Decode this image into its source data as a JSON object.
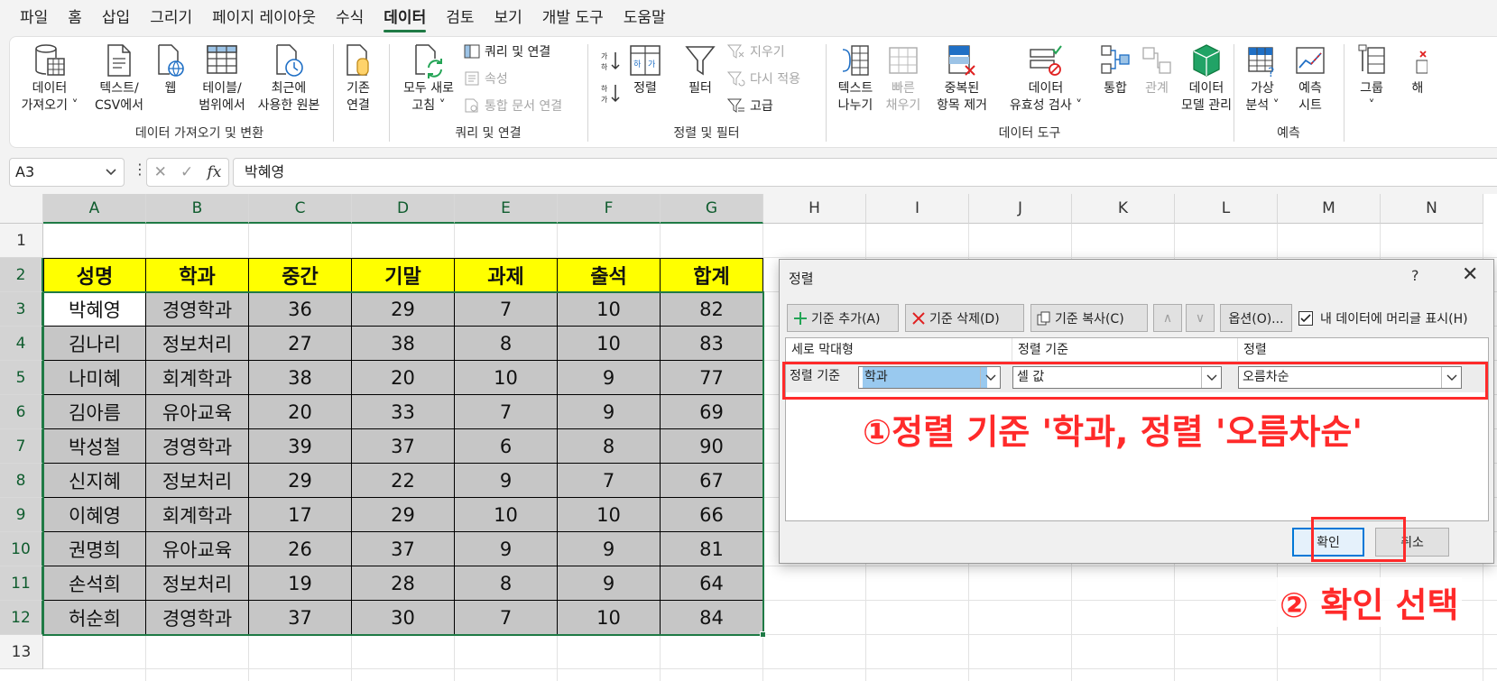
{
  "menu": {
    "tabs": [
      "파일",
      "홈",
      "삽입",
      "그리기",
      "페이지 레이아웃",
      "수식",
      "데이터",
      "검토",
      "보기",
      "개발 도구",
      "도움말"
    ],
    "active": "데이터"
  },
  "ribbon": {
    "get_data": {
      "title": "데이터 가져오기 및 변환",
      "get_data": [
        "데이터",
        "가져오기 ˅"
      ],
      "text_csv": [
        "텍스트/",
        "CSV에서"
      ],
      "web": "웹",
      "table_range": [
        "테이블/",
        "범위에서"
      ],
      "recent": [
        "최근에",
        "사용한 원본"
      ],
      "existing": [
        "기존",
        "연결"
      ]
    },
    "queries": {
      "title": "쿼리 및 연결",
      "refresh": [
        "모두 새로",
        "고침 ˅"
      ],
      "queries_conn": "쿼리 및 연결",
      "properties": "속성",
      "edit_links": "통합 문서 연결"
    },
    "sort_filter": {
      "title": "정렬 및 필터",
      "sort": "정렬",
      "filter": "필터",
      "clear": "지우기",
      "reapply": "다시 적용",
      "advanced": "고급"
    },
    "data_tools": {
      "title": "데이터 도구",
      "text_to_cols": [
        "텍스트",
        "나누기"
      ],
      "flash_fill": [
        "빠른",
        "채우기"
      ],
      "remove_dup": [
        "중복된",
        "항목 제거"
      ],
      "validation": [
        "데이터",
        "유효성 검사 ˅"
      ],
      "consolidate": "통합",
      "relations": "관계",
      "data_model": [
        "데이터",
        "모델 관리"
      ]
    },
    "forecast": {
      "title": "예측",
      "whatif": [
        "가상",
        "분석 ˅"
      ],
      "sheet": [
        "예측",
        "시트"
      ]
    },
    "outline": {
      "group": [
        "그룹",
        "˅"
      ],
      "ungroup_partial": "해"
    }
  },
  "formula_bar": {
    "name_box": "A3",
    "value": "박혜영",
    "fx": "fx"
  },
  "columns": [
    "A",
    "B",
    "C",
    "D",
    "E",
    "F",
    "G",
    "H",
    "I",
    "J",
    "K",
    "L",
    "M",
    "N"
  ],
  "rows": [
    "1",
    "2",
    "3",
    "4",
    "5",
    "6",
    "7",
    "8",
    "9",
    "10",
    "11",
    "12",
    "13"
  ],
  "table": {
    "headers": [
      "성명",
      "학과",
      "중간",
      "기말",
      "과제",
      "출석",
      "합계"
    ],
    "rows": [
      [
        "박혜영",
        "경영학과",
        "36",
        "29",
        "7",
        "10",
        "82"
      ],
      [
        "김나리",
        "정보처리",
        "27",
        "38",
        "8",
        "10",
        "83"
      ],
      [
        "나미혜",
        "회계학과",
        "38",
        "20",
        "10",
        "9",
        "77"
      ],
      [
        "김아름",
        "유아교육",
        "20",
        "33",
        "7",
        "9",
        "69"
      ],
      [
        "박성철",
        "경영학과",
        "39",
        "37",
        "6",
        "8",
        "90"
      ],
      [
        "신지혜",
        "정보처리",
        "29",
        "22",
        "9",
        "7",
        "67"
      ],
      [
        "이혜영",
        "회계학과",
        "17",
        "29",
        "10",
        "10",
        "66"
      ],
      [
        "권명희",
        "유아교육",
        "26",
        "37",
        "9",
        "9",
        "81"
      ],
      [
        "손석희",
        "정보처리",
        "19",
        "28",
        "8",
        "9",
        "64"
      ],
      [
        "허순희",
        "경영학과",
        "37",
        "30",
        "7",
        "10",
        "84"
      ]
    ]
  },
  "dialog": {
    "title": "정렬",
    "help": "?",
    "close": "✕",
    "add_level": "기준 추가(A)",
    "delete_level": "기준 삭제(D)",
    "copy_level": "기준 복사(C)",
    "up": "∧",
    "down": "∨",
    "options": "옵션(O)...",
    "has_headers": "내 데이터에 머리글 표시(H)",
    "col_headers": {
      "column": "세로 막대형",
      "sort_on": "정렬 기준",
      "order": "정렬"
    },
    "row": {
      "label": "정렬 기준",
      "column": "학과",
      "sort_on": "셀 값",
      "order": "오름차순"
    },
    "ok": "확인",
    "cancel": "취소"
  },
  "annotations": {
    "step1": "①정렬 기준 '학과, 정렬 '오름차순'",
    "step2": "② 확인 선택"
  }
}
